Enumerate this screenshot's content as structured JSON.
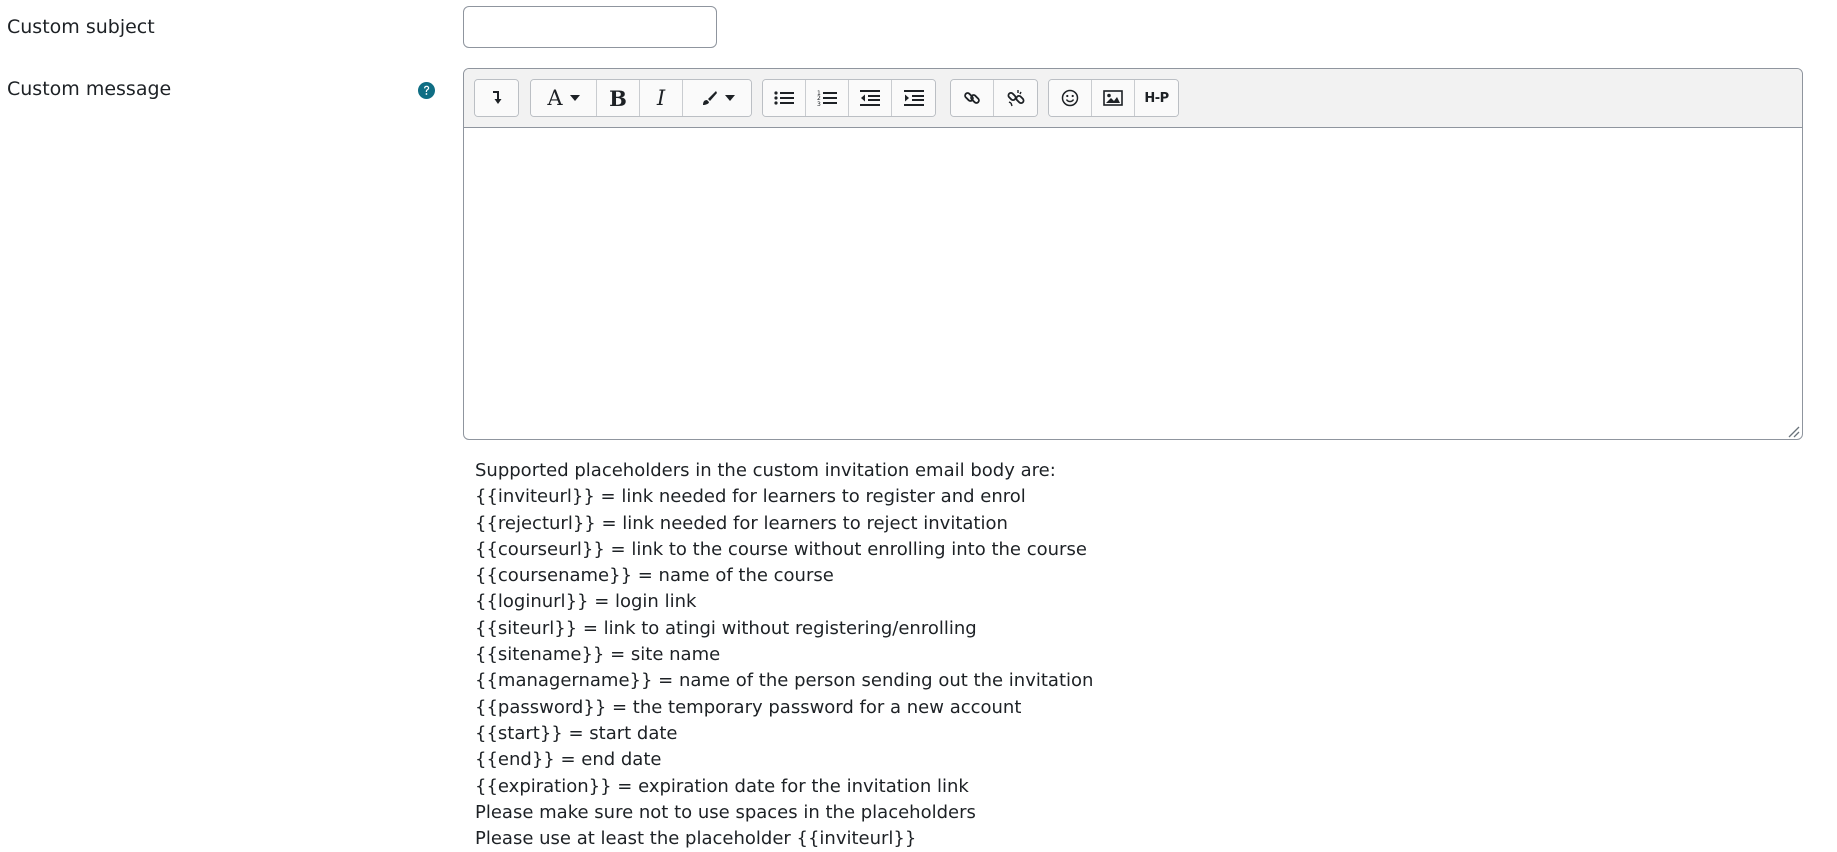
{
  "form": {
    "subject": {
      "label": "Custom subject",
      "value": "",
      "placeholder": ""
    },
    "message": {
      "label": "Custom message",
      "help_icon": "question-circle-icon",
      "content": ""
    }
  },
  "editor": {
    "toolbar": [
      {
        "group": "collapse",
        "buttons": [
          {
            "icon": "show-more-icon"
          }
        ]
      },
      {
        "group": "style",
        "buttons": [
          {
            "icon": "font-style-icon",
            "glyph": "A",
            "dropdown": true
          },
          {
            "icon": "bold-icon",
            "glyph": "B"
          },
          {
            "icon": "italic-icon",
            "glyph": "I"
          },
          {
            "icon": "font-color-icon",
            "dropdown": true
          }
        ]
      },
      {
        "group": "list",
        "buttons": [
          {
            "icon": "unordered-list-icon"
          },
          {
            "icon": "ordered-list-icon"
          },
          {
            "icon": "outdent-icon"
          },
          {
            "icon": "indent-icon"
          }
        ]
      },
      {
        "group": "links",
        "buttons": [
          {
            "icon": "link-icon"
          },
          {
            "icon": "unlink-icon"
          }
        ]
      },
      {
        "group": "insert",
        "buttons": [
          {
            "icon": "emoji-icon"
          },
          {
            "icon": "image-icon"
          },
          {
            "icon": "h5p-icon",
            "glyph": "H-P"
          }
        ]
      }
    ],
    "accent_color": "#0f6cbf",
    "help_color": "#0f6e84"
  },
  "help_lines": [
    "Supported placeholders in the custom invitation email body are:",
    "{{inviteurl}} = link needed for learners to register and enrol",
    "{{rejecturl}} = link needed for learners to reject invitation",
    "{{courseurl}} = link to the course without enrolling into the course",
    "{{coursename}} = name of the course",
    "{{loginurl}} = login link",
    "{{siteurl}} = link to atingi without registering/enrolling",
    "{{sitename}} = site name",
    "{{managername}} = name of the person sending out the invitation",
    "{{password}} = the temporary password for a new account",
    "{{start}} = start date",
    "{{end}} = end date",
    "{{expiration}} = expiration date for the invitation link",
    "Please make sure not to use spaces in the placeholders",
    "Please use at least the placeholder {{inviteurl}}"
  ]
}
